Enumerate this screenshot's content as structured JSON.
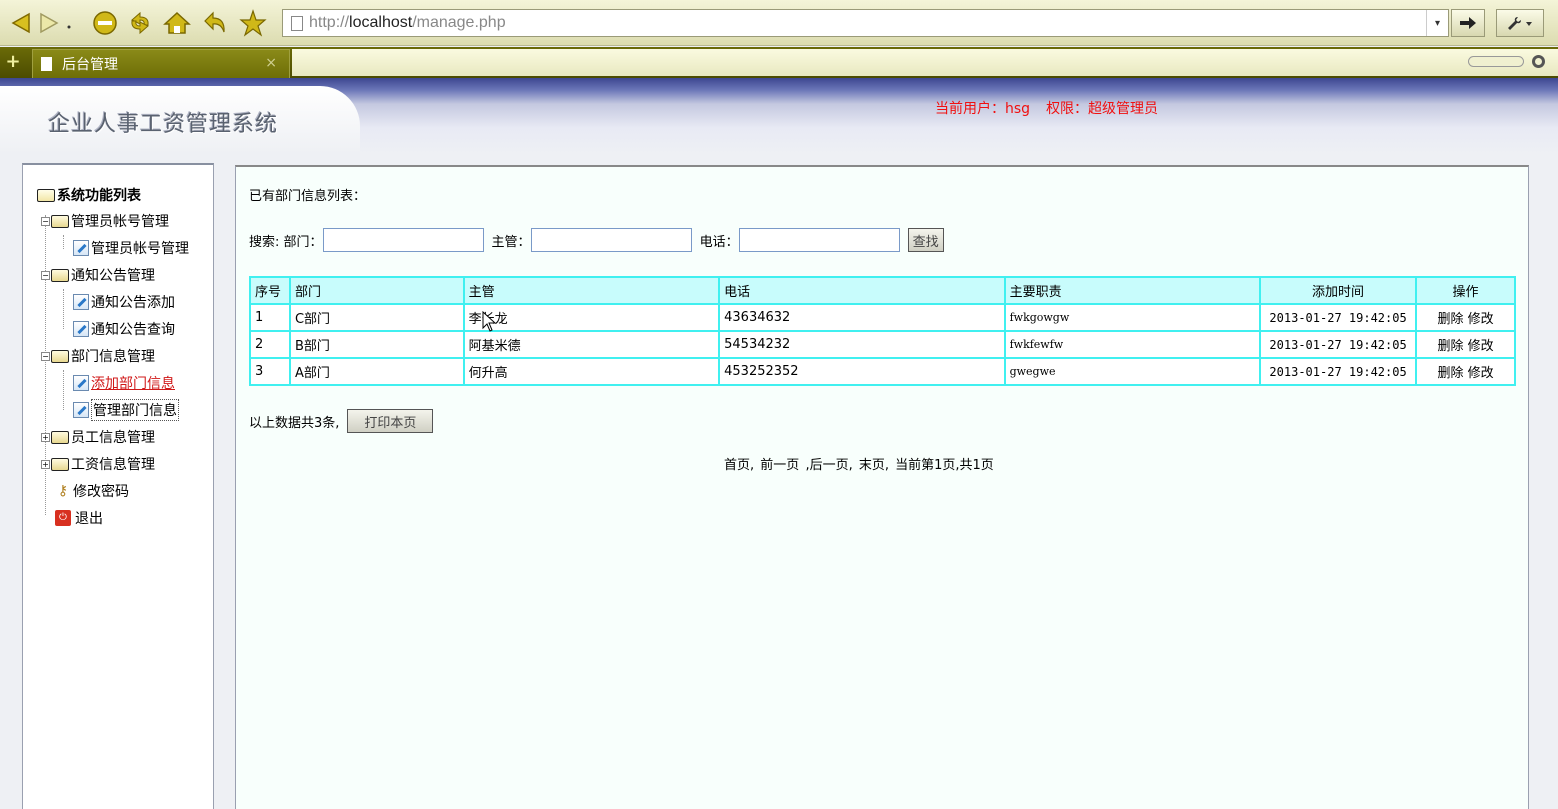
{
  "browser": {
    "url_prefix": "http://",
    "url_host": "localhost",
    "url_path": "/manage.php",
    "tab_title": "后台管理",
    "tab_close": "×",
    "new_tab": "+",
    "icons": [
      "back-icon",
      "forward-icon",
      "stop-icon",
      "reload-icon",
      "home-icon",
      "undo-icon",
      "bookmark-star-icon",
      "go-arrow-icon",
      "wrench-icon"
    ]
  },
  "header": {
    "system_title": "企业人事工资管理系统",
    "current_user": "当前用户：hsg",
    "permission": "权限：超级管理员"
  },
  "sidebar": {
    "root": "系统功能列表",
    "groups": [
      {
        "label": "管理员帐号管理",
        "expanded": true,
        "items": [
          "管理员帐号管理"
        ]
      },
      {
        "label": "通知公告管理",
        "expanded": true,
        "items": [
          "通知公告添加",
          "通知公告查询"
        ]
      },
      {
        "label": "部门信息管理",
        "expanded": true,
        "items": [
          "添加部门信息",
          "管理部门信息"
        ]
      },
      {
        "label": "员工信息管理",
        "expanded": false,
        "items": []
      },
      {
        "label": "工资信息管理",
        "expanded": false,
        "items": []
      }
    ],
    "change_password": "修改密码",
    "logout": "退出"
  },
  "main": {
    "list_title": "已有部门信息列表：",
    "search": {
      "label": "搜索:",
      "dept_label": "部门：",
      "manager_label": "主管：",
      "phone_label": "电话：",
      "dept_value": "",
      "manager_value": "",
      "phone_value": "",
      "button": "查找"
    },
    "table": {
      "columns": [
        "序号",
        "部门",
        "主管",
        "电话",
        "主要职责",
        "添加时间",
        "操作"
      ],
      "rows": [
        {
          "no": "1",
          "dept": "C部门",
          "manager": "李长龙",
          "phone": "43634632",
          "duty": "fwkgowgw",
          "time": "2013-01-27 19:42:05",
          "delete": "删除",
          "edit": "修改"
        },
        {
          "no": "2",
          "dept": "B部门",
          "manager": "阿基米德",
          "phone": "54534232",
          "duty": "fwkfewfw",
          "time": "2013-01-27 19:42:05",
          "delete": "删除",
          "edit": "修改"
        },
        {
          "no": "3",
          "dept": "A部门",
          "manager": "何升高",
          "phone": "453252352",
          "duty": "gwegwe",
          "time": "2013-01-27 19:42:05",
          "delete": "删除",
          "edit": "修改"
        }
      ]
    },
    "summary": "以上数据共3条,",
    "print_button": "打印本页",
    "pager": {
      "first": "首页,",
      "prev": "前一页",
      "next": ",后一页,",
      "last": "末页,",
      "current": "当前第1页,共1页"
    }
  }
}
